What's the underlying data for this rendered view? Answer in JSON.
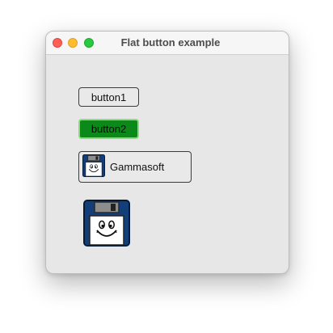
{
  "window": {
    "title": "Flat button example"
  },
  "buttons": {
    "button1_label": "button1",
    "button2_label": "button2",
    "button3_label": "Gammasoft"
  },
  "icons": {
    "small": "floppy-disk-icon",
    "large": "floppy-disk-icon"
  },
  "colors": {
    "button2_fill": "#0b8a1a",
    "button2_border": "#80e079",
    "floppy_body": "#123f7a"
  }
}
